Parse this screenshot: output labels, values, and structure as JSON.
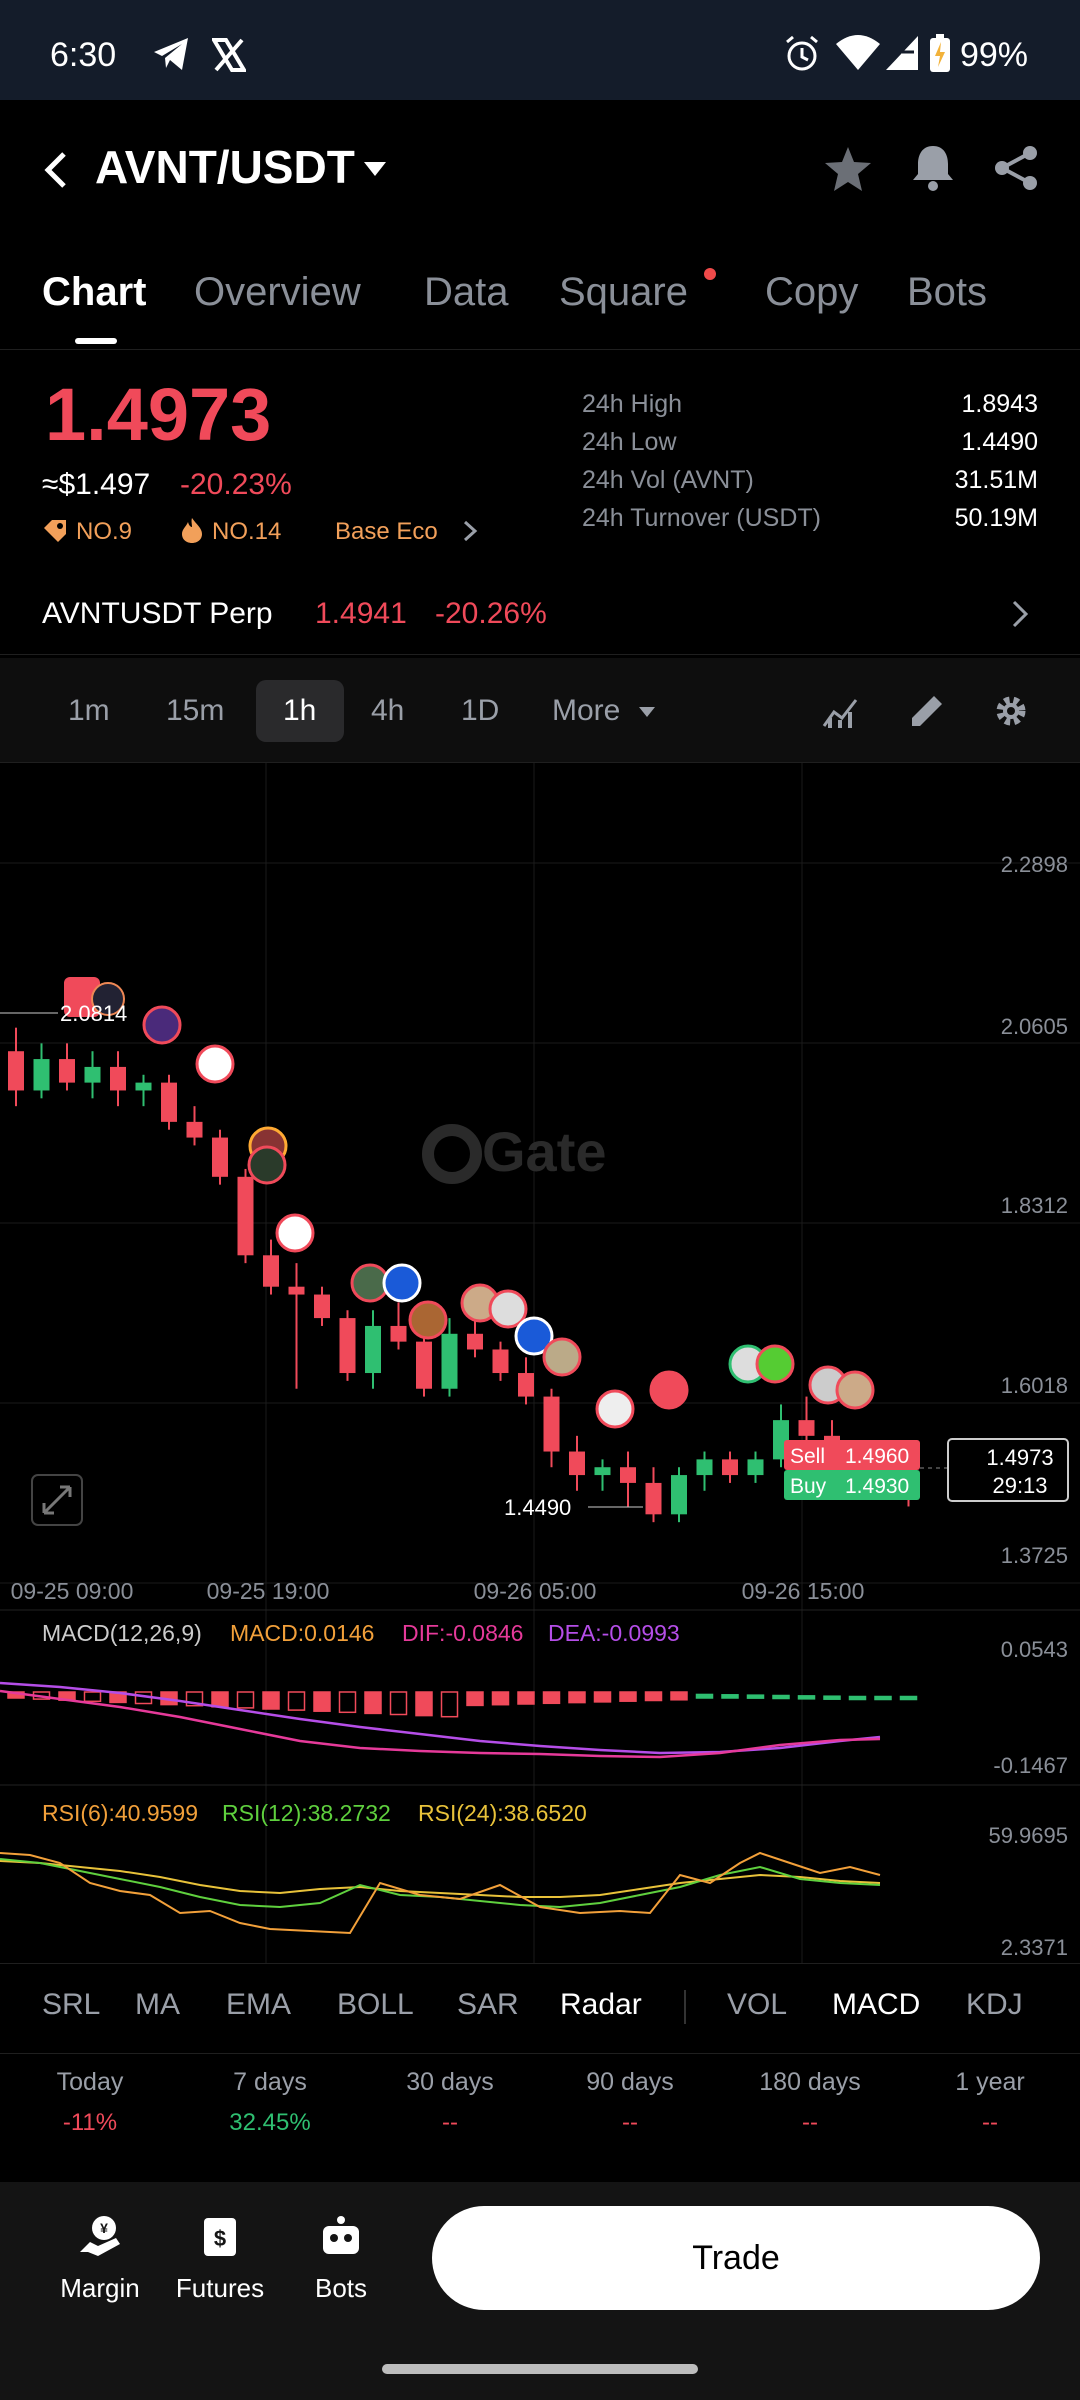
{
  "status_bar": {
    "time": "6:30",
    "battery": "99%",
    "icons": [
      "telegram-icon",
      "x-icon",
      "alarm-icon",
      "wifi-icon",
      "signal-icon",
      "battery-icon"
    ]
  },
  "header": {
    "pair": "AVNT/USDT",
    "icons": [
      "back-icon",
      "chevron-down-icon",
      "star-icon",
      "bell-icon",
      "share-icon"
    ]
  },
  "tabs": [
    {
      "label": "Chart",
      "active": true
    },
    {
      "label": "Overview"
    },
    {
      "label": "Data"
    },
    {
      "label": "Square",
      "dot": true
    },
    {
      "label": "Copy"
    },
    {
      "label": "Bots"
    }
  ],
  "price": {
    "last": "1.4973",
    "usd": "≈$1.497",
    "change": "-20.23%",
    "tag1": "NO.9",
    "tag2": "NO.14",
    "tag3": "Base Eco",
    "stats": [
      {
        "label": "24h High",
        "value": "1.8943"
      },
      {
        "label": "24h Low",
        "value": "1.4490"
      },
      {
        "label": "24h Vol (AVNT)",
        "value": "31.51M"
      },
      {
        "label": "24h Turnover (USDT)",
        "value": "50.19M"
      }
    ]
  },
  "perp": {
    "name": "AVNTUSDT Perp",
    "price": "1.4941",
    "change": "-20.26%"
  },
  "intervals": [
    "1m",
    "15m",
    "1h",
    "4h",
    "1D"
  ],
  "interval_active": "1h",
  "interval_more": "More",
  "chart": {
    "watermark": "Gate",
    "y_ticks": [
      "2.2898",
      "2.0605",
      "1.8312",
      "1.6018",
      "1.3725"
    ],
    "x_ticks": [
      "09-25 09:00",
      "09-25 19:00",
      "09-26 05:00",
      "09-26 15:00"
    ],
    "high_marker": "2.0814",
    "low_marker": "1.4490",
    "sell_label": "Sell",
    "sell_price": "1.4960",
    "buy_label": "Buy",
    "buy_price": "1.4930",
    "current_price": "1.4973",
    "countdown": "29:13",
    "macd_title": "MACD(12,26,9)",
    "macd_val": "MACD:0.0146",
    "dif_val": "DIF:-0.0846",
    "dea_val": "DEA:-0.0993",
    "macd_y_top": "0.0543",
    "macd_y_bot": "-0.1467",
    "rsi6": "RSI(6):40.9599",
    "rsi12": "RSI(12):38.2732",
    "rsi24": "RSI(24):38.6520",
    "rsi_y_top": "59.9695",
    "rsi_y_bot": "2.3371"
  },
  "colors": {
    "up": "#2fbf71",
    "down": "#f04a5a",
    "macd_dif": "#e63a9a",
    "macd_dea": "#b54ee8",
    "rsi6": "#f2a03a",
    "rsi12": "#5fd03e",
    "rsi24": "#e8c23a"
  },
  "chart_data": {
    "type": "candlestick",
    "ohlc": [
      [
        2.05,
        2.08,
        1.98,
        2.0
      ],
      [
        2.0,
        2.06,
        1.99,
        2.04
      ],
      [
        2.04,
        2.06,
        2.0,
        2.01
      ],
      [
        2.01,
        2.05,
        1.99,
        2.03
      ],
      [
        2.03,
        2.05,
        1.98,
        2.0
      ],
      [
        2.0,
        2.02,
        1.98,
        2.01
      ],
      [
        2.01,
        2.02,
        1.95,
        1.96
      ],
      [
        1.96,
        1.98,
        1.93,
        1.94
      ],
      [
        1.94,
        1.95,
        1.88,
        1.89
      ],
      [
        1.89,
        1.9,
        1.78,
        1.79
      ],
      [
        1.79,
        1.81,
        1.74,
        1.75
      ],
      [
        1.75,
        1.78,
        1.62,
        1.74
      ],
      [
        1.74,
        1.75,
        1.7,
        1.71
      ],
      [
        1.71,
        1.72,
        1.63,
        1.64
      ],
      [
        1.64,
        1.72,
        1.62,
        1.7
      ],
      [
        1.7,
        1.73,
        1.67,
        1.68
      ],
      [
        1.68,
        1.69,
        1.61,
        1.62
      ],
      [
        1.62,
        1.71,
        1.61,
        1.69
      ],
      [
        1.69,
        1.71,
        1.66,
        1.67
      ],
      [
        1.67,
        1.68,
        1.63,
        1.64
      ],
      [
        1.64,
        1.66,
        1.6,
        1.61
      ],
      [
        1.61,
        1.62,
        1.52,
        1.54
      ],
      [
        1.54,
        1.56,
        1.49,
        1.51
      ],
      [
        1.51,
        1.53,
        1.49,
        1.52
      ],
      [
        1.52,
        1.54,
        1.47,
        1.5
      ],
      [
        1.5,
        1.52,
        1.45,
        1.46
      ],
      [
        1.46,
        1.52,
        1.45,
        1.51
      ],
      [
        1.51,
        1.54,
        1.49,
        1.53
      ],
      [
        1.53,
        1.54,
        1.5,
        1.51
      ],
      [
        1.51,
        1.54,
        1.5,
        1.53
      ],
      [
        1.53,
        1.6,
        1.52,
        1.58
      ],
      [
        1.58,
        1.61,
        1.55,
        1.56
      ],
      [
        1.56,
        1.58,
        1.52,
        1.53
      ],
      [
        1.53,
        1.55,
        1.49,
        1.5
      ],
      [
        1.5,
        1.53,
        1.48,
        1.52
      ],
      [
        1.52,
        1.53,
        1.47,
        1.48
      ]
    ],
    "y_range": [
      1.3725,
      2.2898
    ],
    "x_ticks": [
      "09-25 09:00",
      "09-25 19:00",
      "09-26 05:00",
      "09-26 15:00"
    ]
  },
  "indicators_main": [
    "SRL",
    "MA",
    "EMA",
    "BOLL",
    "SAR",
    "Radar"
  ],
  "indicators_main_active": "Radar",
  "indicators_sub": [
    "VOL",
    "MACD",
    "KDJ"
  ],
  "indicators_sub_active": "MACD",
  "performance": [
    {
      "label": "Today",
      "value": "-11%",
      "color": "#f04a5a"
    },
    {
      "label": "7 days",
      "value": "32.45%",
      "color": "#2fbf71"
    },
    {
      "label": "30 days",
      "value": "--",
      "color": "#f04a5a"
    },
    {
      "label": "90 days",
      "value": "--",
      "color": "#f04a5a"
    },
    {
      "label": "180 days",
      "value": "--",
      "color": "#f04a5a"
    },
    {
      "label": "1 year",
      "value": "--",
      "color": "#f04a5a"
    }
  ],
  "bottom_nav": {
    "margin": "Margin",
    "futures": "Futures",
    "bots": "Bots",
    "trade": "Trade"
  }
}
